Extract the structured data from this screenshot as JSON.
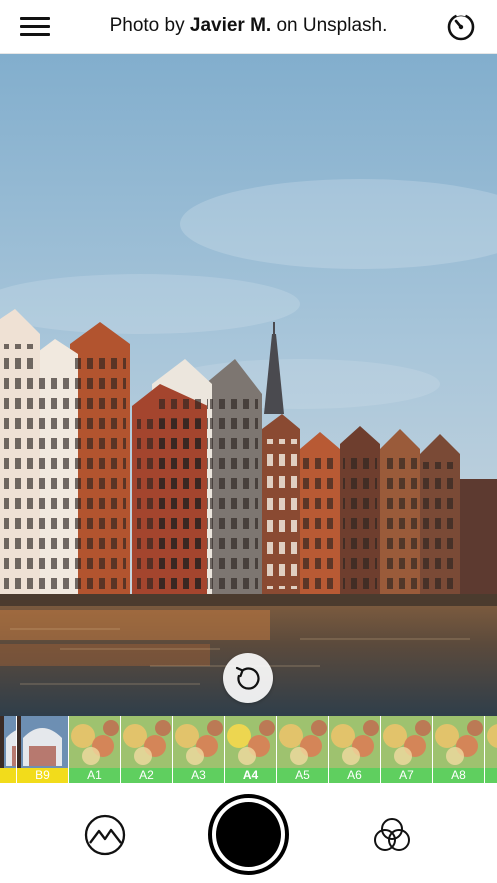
{
  "header": {
    "title_prefix": "Photo by",
    "title_author": "Javier M.",
    "title_suffix": "on Unsplash.",
    "menu_icon": "hamburger-menu-icon",
    "timer_icon": "timer-icon"
  },
  "photo": {
    "subject": "canal houses photo",
    "rotate_icon": "rotate-icon"
  },
  "filters": [
    {
      "label": "",
      "group": "B",
      "partial": true
    },
    {
      "label": "B9",
      "group": "B"
    },
    {
      "label": "A1",
      "group": "A"
    },
    {
      "label": "A2",
      "group": "A"
    },
    {
      "label": "A3",
      "group": "A"
    },
    {
      "label": "A4",
      "group": "A",
      "selected": true
    },
    {
      "label": "A5",
      "group": "A"
    },
    {
      "label": "A6",
      "group": "A"
    },
    {
      "label": "A7",
      "group": "A"
    },
    {
      "label": "A8",
      "group": "A"
    },
    {
      "label": "",
      "group": "A",
      "partial": true
    }
  ],
  "toolbar": {
    "gallery_icon": "mountain-gallery-icon",
    "shutter_icon": "shutter-button",
    "blend_icon": "color-circles-icon"
  },
  "colors": {
    "filter_a": "#5fcf5f",
    "filter_b": "#f2dc1b",
    "sky_top": "#8fb4d0",
    "water": "#3b4a55"
  }
}
